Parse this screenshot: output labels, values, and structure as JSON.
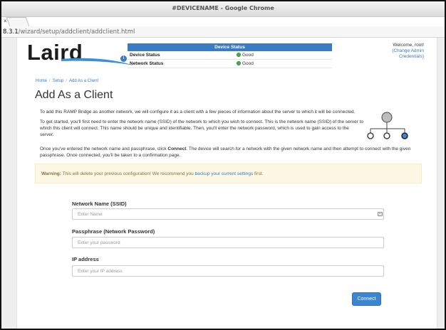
{
  "browser": {
    "window_title": "#DEVICENAME - Google Chrome",
    "tab_close": "×",
    "url_host": "8.3.1",
    "url_path": "/wizard/setup/addclient/addclient.html"
  },
  "header": {
    "logo_text": "Laird",
    "status": {
      "title": "Device Status",
      "info_icon": "i",
      "rows": [
        {
          "label": "Device Status",
          "value": "Good"
        },
        {
          "label": "Network Status",
          "value": "Good"
        }
      ]
    },
    "welcome_text": "Welcome, root!",
    "admin_link": "(Change Admin Credentials)"
  },
  "breadcrumb": [
    "Home",
    "Setup",
    "Add As a Client"
  ],
  "page_title": "Add As a Client",
  "intro": {
    "p1": "To add this RAMP Bridge as another network, we will configure it as a client with a few pieces of information about the server to which it will be connected.",
    "p2": "To get started, you'll first need to enter the network name (SSID) of the network to which you wish to connect. This is the network name (SSID) of the server to which this client will connect. This name should be unique and identifiable. Then, you'll enter the network password, which is used to gain access to the server.",
    "p3_before": "Once you've entered the network name and passphrase, click ",
    "p3_bold": "Connect",
    "p3_after": ". The device will search for a network with the given network name and then attempt to connect with the given passphrase. Once connected, you'll be taken to a confirmation page."
  },
  "warning": {
    "label": "Warning:",
    "text": " This will delete your previous configuration! We recommend you ",
    "link": "backup your current settings",
    "end": " first."
  },
  "form": {
    "ssid_label": "Network Name (SSID)",
    "ssid_placeholder": "Enter Name",
    "pass_label": "Passphrase (Network Password)",
    "pass_placeholder": "Enter your password",
    "ip_label": "IP address",
    "ip_placeholder": "Enter your IP address",
    "connect_label": "Connect"
  },
  "colors": {
    "accent": "#3a7cc4",
    "status_good": "#47b04a",
    "warning_bg": "#fcf8e3"
  }
}
